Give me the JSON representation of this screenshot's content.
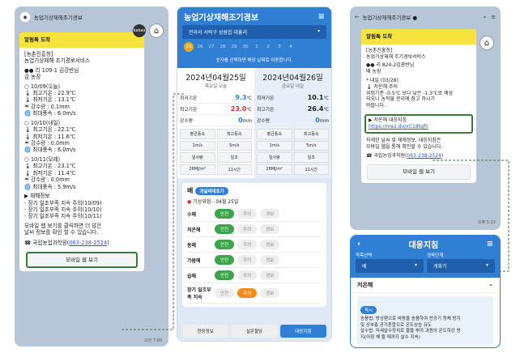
{
  "panel1": {
    "chat_title": "농업기상재해조기경보",
    "kakao": "kakao",
    "alert": "알림톡 도착",
    "lines": [
      "[농촌진흥청]",
      "농업기상재해 조기경보서비스",
      "",
      "●● 리 109-1 김강반님",
      "감 농장",
      "",
      "○ 10/09(오늘)",
      "🌡 최고기온 : 22.9℃",
      "🌡 최저기온 : 13.1℃",
      "☔ 강수량 : 0.1mm",
      "🌀 최대풍속 : 6.0m/s",
      "",
      "○ 10/10(내일)",
      "🌡 최고기온 : 22.1℃",
      "🌡 최저기온 : 11.6℃",
      "☔ 강수량 : 0.0mm",
      "🌀 최대풍속 : 6.0m/s",
      "",
      "○ 10/11(모레)",
      "🌡 최고기온 : 23.1℃",
      "🌡 최저기온 : 11.4℃",
      "☔ 강수량 : 0.0mm",
      "🌀 최대풍속 : 5.9m/s",
      "",
      "▶ 재해정보",
      "- 장기 일조부족 지속 주의(10/09)",
      "- 장기 일조부족 지속 주의(10/10)",
      "- 장기 일조부족 지속 주의(10/11)",
      "",
      "모바일 웹 보기를 클릭하면 더 많은",
      "날씨 정보를 확인 할 수 있습니다."
    ],
    "phone_label": "☎ 국립농업과학원(",
    "phone": "063-238-2524",
    ")": ")",
    "button": "모바일 웹 보기",
    "time": "오전 7:00"
  },
  "panel2": {
    "title": "농업기상재해조기경보",
    "menu": "≡",
    "region": "전라서 서락구 성람읍 대흥리",
    "days": [
      "25",
      "26",
      "27",
      "28",
      "29",
      "30",
      "1",
      "2",
      "3",
      "4"
    ],
    "hint": "숫자를 선택하면 해당 날짜로 이동합니다.",
    "d1": {
      "date": "2024년04월25일",
      "sub": "목요일 오늘",
      "tmax": "9.3",
      "tmin": "23.0",
      "rain": "0",
      "g": [
        "평균풍속",
        "최고풍속",
        "1m/s",
        "5m/s",
        "일사량",
        "일조",
        "28MJ/m²",
        "11시간"
      ]
    },
    "d2": {
      "date": "2024년04월26일",
      "sub": "금요일 내일",
      "tmax": "10.1",
      "tmin": "26.4",
      "rain": "0",
      "g": [
        "평균풍속",
        "최고풍속",
        "1m/s",
        "5m/s",
        "일사량",
        "일조",
        "28MJ/m²",
        "11시간"
      ]
    },
    "labels": {
      "tmax": "최저기온",
      "tmin": "최고기온",
      "rain": "강수량",
      "unit_t": "℃",
      "unit_r": "mm"
    },
    "card_title": "배",
    "card_tag": "과실비대초기",
    "risk": "기상위험 - 04월 25일",
    "risks": [
      [
        "수해",
        "안전",
        "주의",
        "경보"
      ],
      [
        "저온해",
        "안전",
        "주의",
        "경보"
      ],
      [
        "동해",
        "안전",
        "주의",
        "경보"
      ],
      [
        "가뭄해",
        "안전",
        "주의",
        "경보"
      ],
      [
        "습해",
        "안전",
        "주의",
        "경보"
      ],
      [
        "장기 일조부족 지속",
        "안전",
        "주의",
        "경보"
      ]
    ],
    "tabs": [
      "현장정보",
      "실온할당",
      "대응지침"
    ]
  },
  "panel3": {
    "chat_title": "농업기상재해조기경보 ●",
    "alert": "알림톡 도착",
    "lines": [
      "[농촌진흥청]",
      "농업기상재해 조기경보서비스",
      "",
      "●● 리 824-2김광반님",
      "배 농장",
      "",
      "* 내일 (03/28)",
      "🌡 저온해 주의",
      "위험기준 -0.5℃ 보다 낮은 -1.3℃로 예상",
      "되오니 농작물 관리에 참고 하시기",
      "바랍니다."
    ],
    "guide": "▶ 저온해 대응지침",
    "url": "https://me2.do/xC18tgf0",
    "more": [
      "자세한 날씨 및 재해정보, 대응지침은",
      "모바일 웹을 통해 확인할 수 있습니다."
    ],
    "phone_label": "☎ 국립농업과학원(",
    "phone": "063-238-2524",
    "button": "모바일 웹 보기",
    "time": "오후 5:12"
  },
  "panel4": {
    "title": "대응지침",
    "crop_label": "작목선택",
    "stage_label": "생육단계",
    "crop": "배",
    "stage": "개화기",
    "section": "저온해",
    "badge": "즉시",
    "text": [
      "송풍법: 방상팬으로 바람을 송풍하여 찬공기 정체 방지",
      "및 상부층 공기혼합으로 온도상승 유도",
      "살수법: 미세살수장치로 물을 뿌려 과원의 온도하강 방",
      "지(아침 해 뜰 때까지 살수 지속)"
    ]
  }
}
